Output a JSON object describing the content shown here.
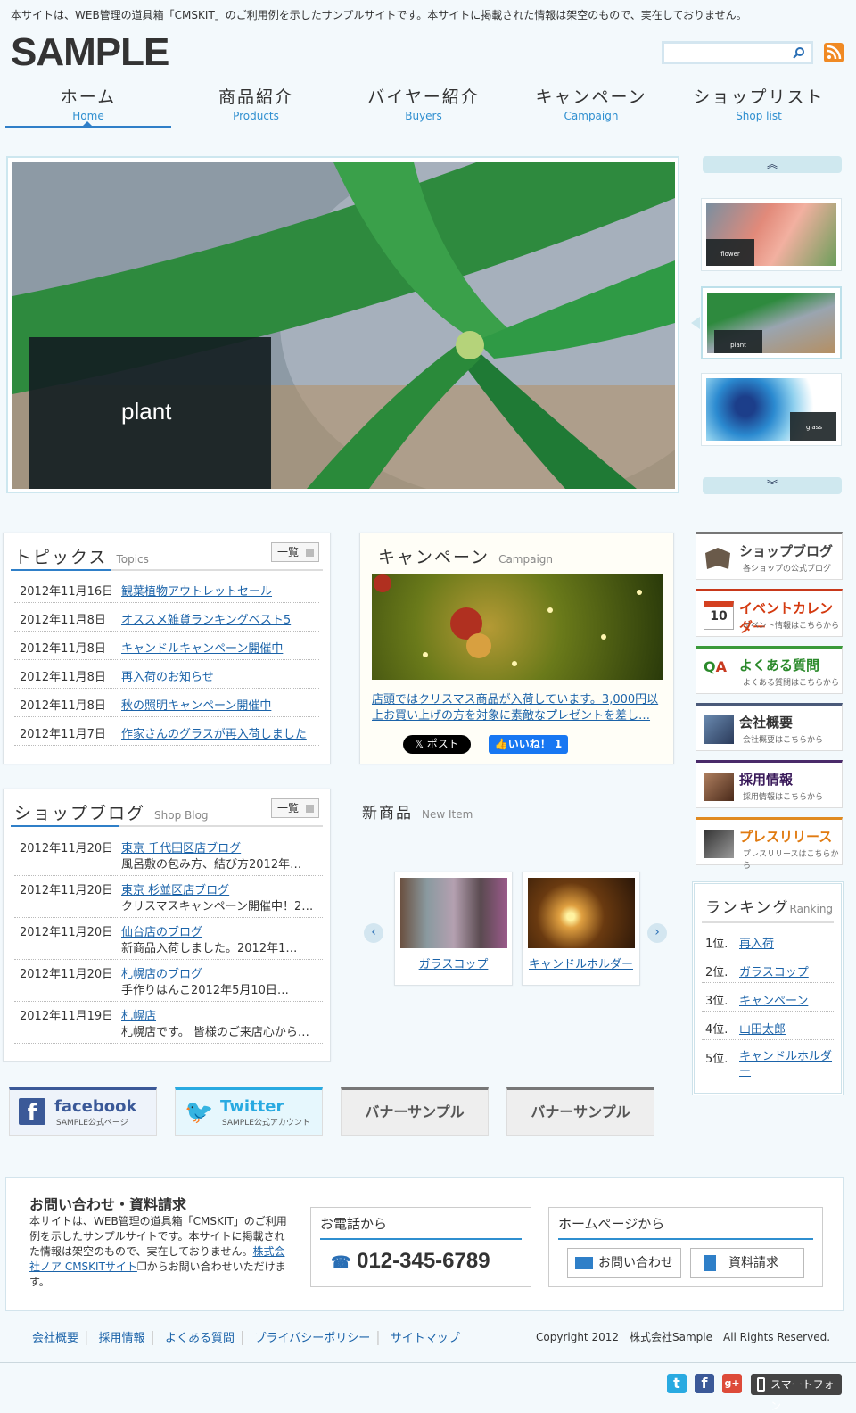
{
  "notice": "本サイトは、WEB管理の道具箱「CMSKIT」のご利用例を示したサンプルサイトです。本サイトに掲載された情報は架空のもので、実在しておりません。",
  "logo": "SAMPLE",
  "search": {
    "placeholder": ""
  },
  "nav": [
    {
      "jp": "ホーム",
      "en": "Home",
      "active": true
    },
    {
      "jp": "商品紹介",
      "en": "Products"
    },
    {
      "jp": "バイヤー紹介",
      "en": "Buyers"
    },
    {
      "jp": "キャンペーン",
      "en": "Campaign"
    },
    {
      "jp": "ショップリスト",
      "en": "Shop list"
    }
  ],
  "slider": {
    "caption": "plant",
    "thumbs": [
      {
        "label": "flower"
      },
      {
        "label": "plant"
      },
      {
        "label": "glass"
      }
    ]
  },
  "topics": {
    "title": "トピックス",
    "sub": "Topics",
    "more": "一覧",
    "items": [
      {
        "date": "2012年11月16日",
        "title": "観葉植物アウトレットセール"
      },
      {
        "date": "2012年11月8日",
        "title": "オススメ雑貨ランキングベスト5"
      },
      {
        "date": "2012年11月8日",
        "title": "キャンドルキャンペーン開催中"
      },
      {
        "date": "2012年11月8日",
        "title": "再入荷のお知らせ"
      },
      {
        "date": "2012年11月8日",
        "title": "秋の照明キャンペーン開催中"
      },
      {
        "date": "2012年11月7日",
        "title": "作家さんのグラスが再入荷しました"
      }
    ]
  },
  "campaign": {
    "title": "キャンペーン",
    "sub": "Campaign",
    "text": "店頭ではクリスマス商品が入荷しています。3,000円以上お買い上げの方を対象に素敵なプレゼントを差し…",
    "post": "ポスト",
    "like": "いいね！ 1"
  },
  "blog": {
    "title": "ショップブログ",
    "sub": "Shop Blog",
    "more": "一覧",
    "items": [
      {
        "date": "2012年11月20日",
        "title": "東京 千代田区店ブログ",
        "excerpt": "風呂敷の包み方、結び方2012年…"
      },
      {
        "date": "2012年11月20日",
        "title": "東京 杉並区店ブログ",
        "excerpt": "クリスマスキャンペーン開催中！2…"
      },
      {
        "date": "2012年11月20日",
        "title": "仙台店のブログ",
        "excerpt": "新商品入荷しました。2012年1…"
      },
      {
        "date": "2012年11月20日",
        "title": "札幌店のブログ",
        "excerpt": "手作りはんこ2012年5月10日…"
      },
      {
        "date": "2012年11月19日",
        "title": "札幌店",
        "excerpt": "札幌店です。 皆様のご来店心から…"
      }
    ]
  },
  "newitem": {
    "title": "新商品",
    "sub": "New Item",
    "items": [
      {
        "name": "ガラスコップ"
      },
      {
        "name": "キャンドルホルダー"
      }
    ]
  },
  "side": [
    {
      "title": "ショップブログ",
      "sub": "各ショップの公式ブログ",
      "color": "#555555",
      "line": "#777777"
    },
    {
      "title": "イベントカレンダー",
      "sub": "イベント情報はこちらから",
      "color": "#d43a10",
      "line": "#c8381a",
      "num": "10"
    },
    {
      "title": "よくある質問",
      "sub": "よくある質問はこちらから",
      "color": "#2b8a2b",
      "line": "#3a9a3a"
    },
    {
      "title": "会社概要",
      "sub": "会社概要はこちらから",
      "color": "#333333",
      "line": "#4a5a7a"
    },
    {
      "title": "採用情報",
      "sub": "採用情報はこちらから",
      "color": "#3a1a5a",
      "line": "#4a2a6a"
    },
    {
      "title": "プレスリリース",
      "sub": "プレスリリースはこちらから",
      "color": "#e07a10",
      "line": "#e08a20"
    }
  ],
  "ranking": {
    "title": "ランキング",
    "sub": "Ranking",
    "items": [
      {
        "rank": "1位.",
        "name": "再入荷"
      },
      {
        "rank": "2位.",
        "name": "ガラスコップ"
      },
      {
        "rank": "3位.",
        "name": "キャンペーン"
      },
      {
        "rank": "4位.",
        "name": "山田太郎"
      },
      {
        "rank": "5位.",
        "name": "キャンドルホルダー"
      }
    ]
  },
  "banners": [
    {
      "title": "facebook",
      "sub": "SAMPLE公式ページ"
    },
    {
      "title": "Twitter",
      "sub": "SAMPLE公式アカウント"
    },
    {
      "title": "バナーサンプル"
    },
    {
      "title": "バナーサンプル"
    }
  ],
  "contact": {
    "title": "お問い合わせ・資料請求",
    "text": "本サイトは、WEB管理の道具箱「CMSKIT」のご利用例を示したサンプルサイトです。本サイトに掲載された情報は架空のもので、実在しておりません。",
    "link": "株式会社ノア CMSKITサイト",
    "after": "からお問い合わせいただけます。",
    "phone_title": "お電話から",
    "phone": "012-345-6789",
    "web_title": "ホームページから",
    "inquiry": "お問い合わせ",
    "request": "資料請求"
  },
  "footer": {
    "links": [
      "会社概要",
      "採用情報",
      "よくある質問",
      "プライバシーポリシー",
      "サイトマップ"
    ],
    "copyright": "Copyright 2012　株式会社Sample　All Rights Reserved.",
    "smartphone": "スマートフォン"
  }
}
